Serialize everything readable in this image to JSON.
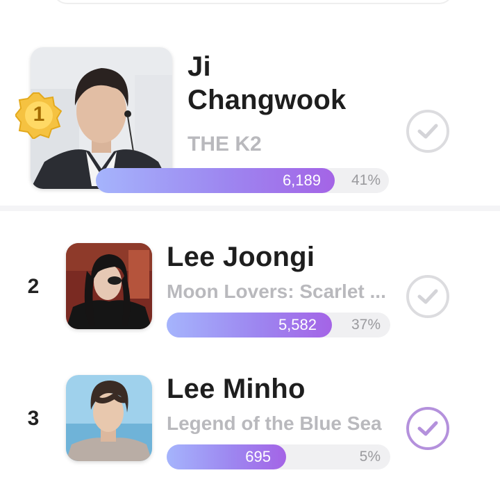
{
  "colors": {
    "bar_gradient_start": "#a5b4fc",
    "bar_gradient_end": "#a464e6",
    "check_selected": "#b491dc",
    "check_unselected": "#dcdcdf",
    "medal_gold": "#f5c241"
  },
  "ranking": [
    {
      "rank": "1",
      "name_line1": "Ji",
      "name_line2": "Changwook",
      "drama": "THE K2",
      "votes": "6,189",
      "percent": "41%",
      "fill": 0.41,
      "selected": false,
      "icon": "rank-1-medal-icon"
    },
    {
      "rank": "2",
      "name": "Lee Joongi",
      "drama": "Moon Lovers: Scarlet ...",
      "votes": "5,582",
      "percent": "37%",
      "fill": 0.37,
      "selected": false
    },
    {
      "rank": "3",
      "name": "Lee Minho",
      "drama": "Legend of the Blue Sea",
      "votes": "695",
      "percent": "5%",
      "fill": 0.05,
      "selected": true
    }
  ]
}
